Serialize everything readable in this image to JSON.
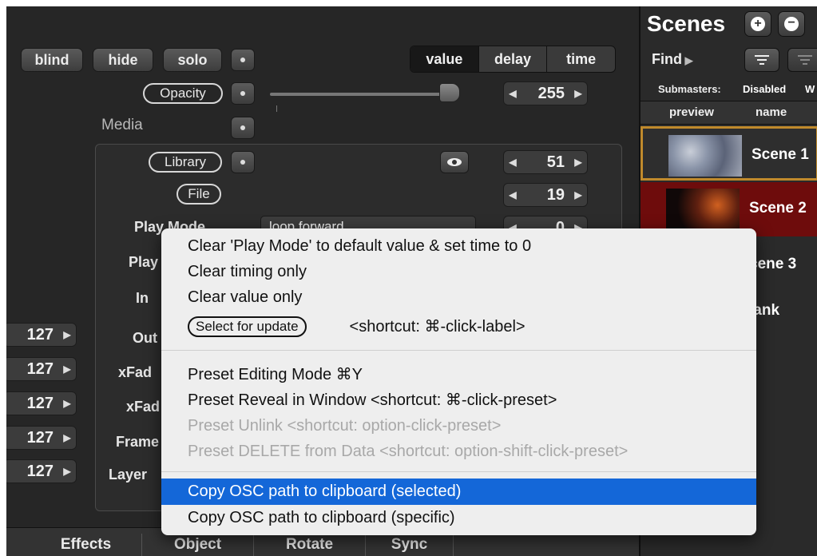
{
  "toolbar": {
    "blind": "blind",
    "hide": "hide",
    "solo": "solo"
  },
  "segmented": [
    "value",
    "delay",
    "time"
  ],
  "opacity": {
    "label": "Opacity",
    "value": "255"
  },
  "media": {
    "label": "Media"
  },
  "library": {
    "label": "Library",
    "value": "51"
  },
  "file": {
    "label": "File",
    "value": "19"
  },
  "play_mode": {
    "label": "Play Mode",
    "select": "loop forward",
    "value": "0"
  },
  "left_steppers": [
    "127",
    "127",
    "127",
    "127",
    "127"
  ],
  "param_labels": [
    "Play",
    "In",
    "Out",
    "xFad",
    "xFad",
    "Frame",
    "Layer"
  ],
  "tabs": [
    "Effects",
    "Object",
    "Rotate",
    "Sync"
  ],
  "scenes": {
    "title": "Scenes",
    "find": "Find",
    "submasters_label": "Submasters:",
    "submasters_value": "Disabled",
    "submasters_extra": "W",
    "col_preview": "preview",
    "col_name": "name",
    "items": [
      "Scene 1",
      "Scene 2",
      "cene 3",
      "lank"
    ]
  },
  "context_menu": {
    "items": [
      "Clear 'Play Mode' to default value & set time to 0",
      "Clear timing only",
      "Clear value only"
    ],
    "select_update": "Select for update",
    "select_shortcut": "<shortcut: ⌘-click-label>",
    "preset_editing": "Preset Editing Mode  ⌘Y",
    "preset_reveal": "Preset Reveal in Window  <shortcut: ⌘-click-preset>",
    "preset_unlink": "Preset Unlink     <shortcut: option-click-preset>",
    "preset_delete": "Preset DELETE from Data <shortcut: option-shift-click-preset>",
    "copy_selected": "Copy OSC path to clipboard (selected)",
    "copy_specific": "Copy OSC path to clipboard (specific)"
  },
  "colors": {
    "highlight": "#1467d8",
    "scene2_bg": "#6e0c0c",
    "scene1_border": "#c08a2c"
  }
}
